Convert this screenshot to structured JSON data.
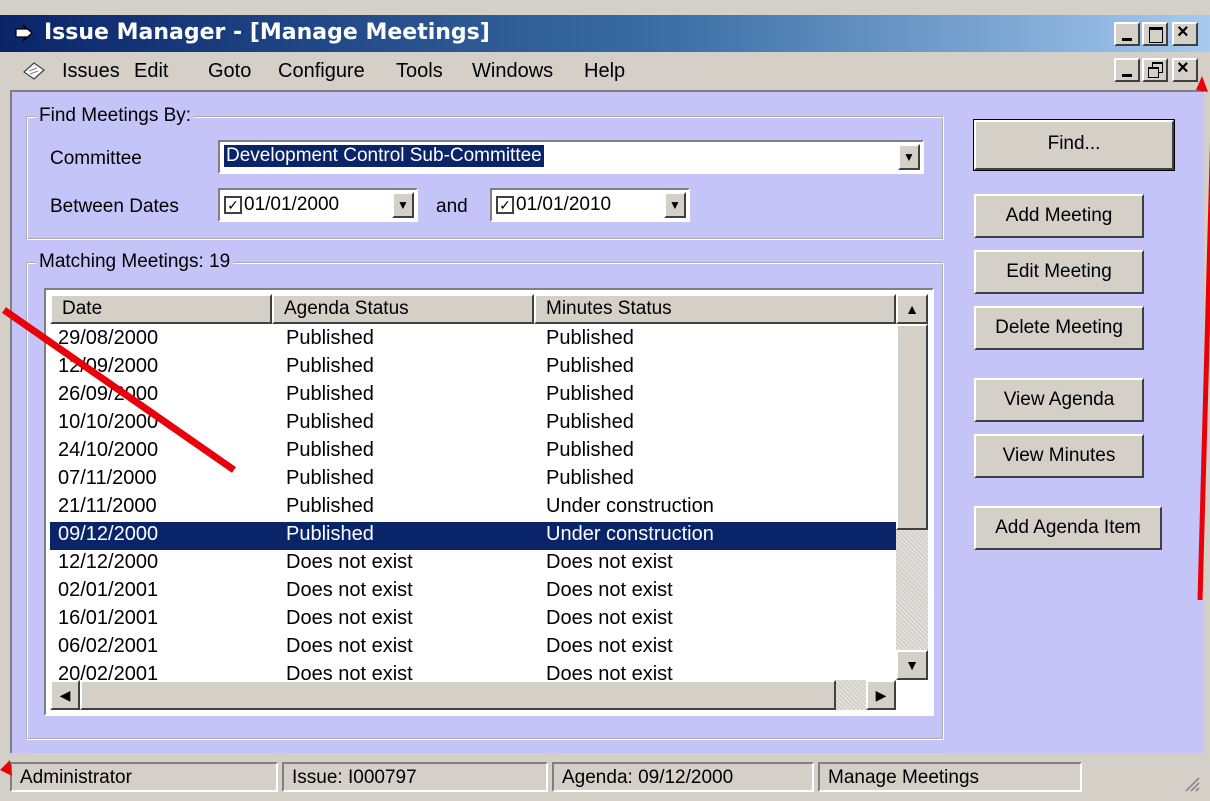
{
  "window": {
    "title": "Issue Manager - [Manage Meetings]",
    "title_controls": [
      "_",
      "□",
      "×"
    ],
    "mdi_controls": [
      "_",
      "▫",
      "×"
    ]
  },
  "menu": {
    "items": [
      "Issues",
      "Edit",
      "Goto",
      "Configure",
      "Tools",
      "Windows",
      "Help"
    ]
  },
  "find": {
    "group_title": "Find Meetings By:",
    "committee_label": "Committee",
    "committee_value": "Development Control Sub-Committee",
    "between_label": "Between Dates",
    "date_from": "01/01/2000",
    "and_label": "and",
    "date_to": "01/01/2010",
    "from_checked": true,
    "to_checked": true
  },
  "results": {
    "group_title": "Matching Meetings: 19",
    "columns": [
      "Date",
      "Agenda Status",
      "Minutes Status"
    ],
    "rows": [
      [
        "29/08/2000",
        "Published",
        "Published"
      ],
      [
        "12/09/2000",
        "Published",
        "Published"
      ],
      [
        "26/09/2000",
        "Published",
        "Published"
      ],
      [
        "10/10/2000",
        "Published",
        "Published"
      ],
      [
        "24/10/2000",
        "Published",
        "Published"
      ],
      [
        "07/11/2000",
        "Published",
        "Published"
      ],
      [
        "21/11/2000",
        "Published",
        "Under construction"
      ],
      [
        "09/12/2000",
        "Published",
        "Under construction"
      ],
      [
        "12/12/2000",
        "Does not exist",
        "Does not exist"
      ],
      [
        "02/01/2001",
        "Does not exist",
        "Does not exist"
      ],
      [
        "16/01/2001",
        "Does not exist",
        "Does not exist"
      ],
      [
        "06/02/2001",
        "Does not exist",
        "Does not exist"
      ],
      [
        "20/02/2001",
        "Does not exist",
        "Does not exist"
      ]
    ],
    "selected_index": 7
  },
  "buttons": {
    "find": "Find...",
    "add_meeting": "Add Meeting",
    "edit_meeting": "Edit Meeting",
    "delete_meeting": "Delete Meeting",
    "view_agenda": "View Agenda",
    "view_minutes": "View Minutes",
    "add_agenda_item": "Add Agenda Item"
  },
  "status": {
    "user": "Administrator",
    "issue": "Issue: I000797",
    "agenda": "Agenda: 09/12/2000",
    "screen": "Manage Meetings"
  },
  "colors": {
    "client_bg": "#c4c4f8",
    "selection": "#0a246a",
    "annotation": "#e8000a"
  }
}
